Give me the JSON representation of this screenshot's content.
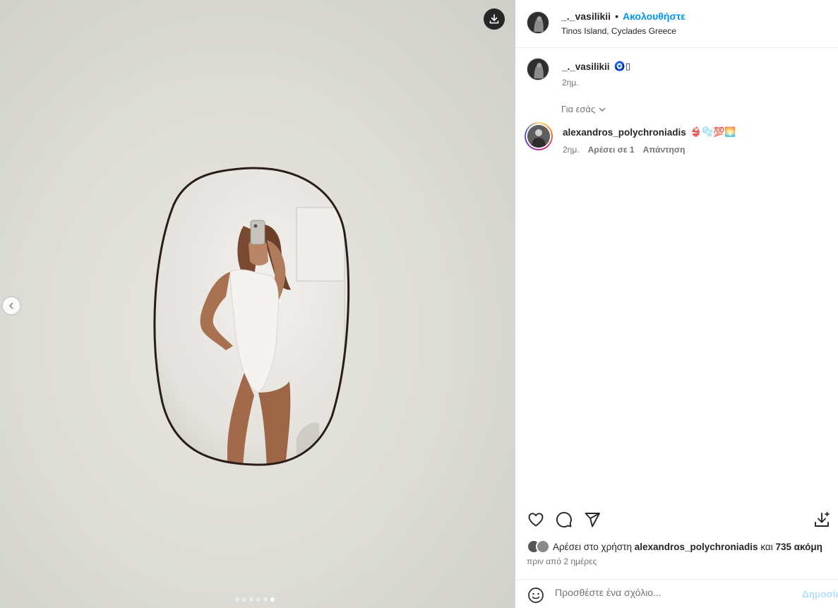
{
  "post": {
    "username": "_._vasilikii",
    "separator": "•",
    "follow_label": "Ακολουθήστε",
    "location": "Tinos Island, Cyclades Greece"
  },
  "caption": {
    "username": "_._vasilikii",
    "emoji": "🧿▯",
    "time": "2ημ."
  },
  "for_you_label": "Για εσάς",
  "comments": [
    {
      "username": "alexandros_polychroniadis",
      "emoji": "👙🫧💯🌅",
      "time": "2ημ.",
      "likes_label": "Αρέσει σε 1",
      "reply_label": "Απάντηση"
    }
  ],
  "likes": {
    "prefix": "Αρέσει στο χρήστη",
    "user": "alexandros_polychroniadis",
    "joiner": "και",
    "others": "735 ακόμη"
  },
  "posted_ago": "πριν από 2 ημέρες",
  "add_comment": {
    "placeholder": "Προσθέστε ένα σχόλιο...",
    "post_label": "Δημοσίευση"
  },
  "carousel": {
    "count": 6,
    "active_index": 5
  },
  "icons": {
    "download": "download-icon",
    "prev": "chevron-left-icon",
    "like": "heart-icon",
    "comment": "comment-icon",
    "share": "send-icon",
    "save": "save-download-icon",
    "emoji": "emoji-smile-icon",
    "chevron": "chevron-down-icon"
  },
  "colors": {
    "accent": "#0095f6",
    "secondary_text": "#737373",
    "post_disabled": "#b2dffc"
  }
}
